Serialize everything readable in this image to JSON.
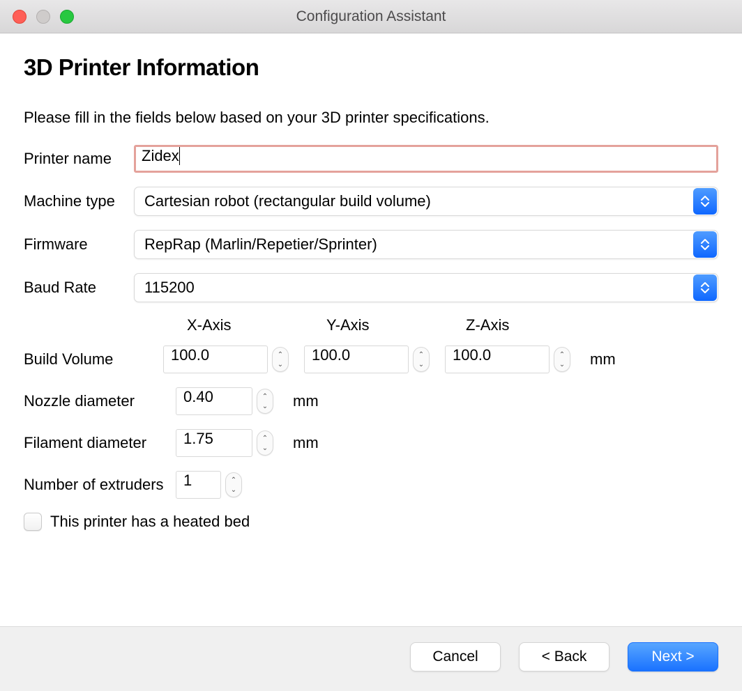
{
  "window": {
    "title": "Configuration Assistant"
  },
  "page": {
    "heading": "3D Printer Information",
    "intro": "Please fill in the fields below based on your 3D printer specifications."
  },
  "fields": {
    "printer_name": {
      "label": "Printer name",
      "value": "Zidex"
    },
    "machine_type": {
      "label": "Machine type",
      "value": "Cartesian robot (rectangular build volume)"
    },
    "firmware": {
      "label": "Firmware",
      "value": "RepRap (Marlin/Repetier/Sprinter)"
    },
    "baud_rate": {
      "label": "Baud Rate",
      "value": "115200"
    },
    "build_volume": {
      "label": "Build Volume",
      "axes": {
        "x": "X-Axis",
        "y": "Y-Axis",
        "z": "Z-Axis"
      },
      "values": {
        "x": "100.0",
        "y": "100.0",
        "z": "100.0"
      },
      "unit": "mm"
    },
    "nozzle_diameter": {
      "label": "Nozzle diameter",
      "value": "0.40",
      "unit": "mm"
    },
    "filament_diameter": {
      "label": "Filament diameter",
      "value": "1.75",
      "unit": "mm"
    },
    "extruders": {
      "label": "Number of extruders",
      "value": "1"
    },
    "heated_bed": {
      "label": "This printer has a heated bed",
      "checked": false
    }
  },
  "footer": {
    "cancel": "Cancel",
    "back": "< Back",
    "next": "Next >"
  }
}
